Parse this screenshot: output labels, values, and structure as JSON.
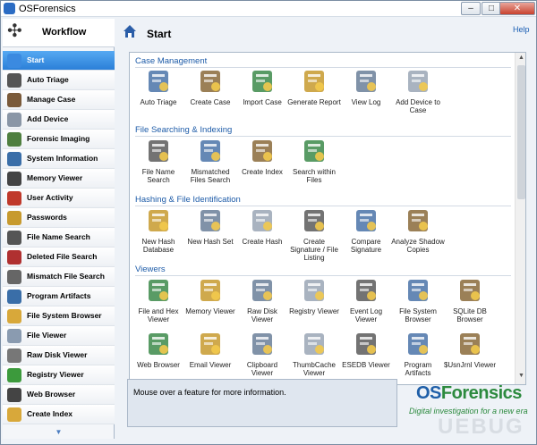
{
  "window": {
    "title": "OSForensics",
    "min": "–",
    "max": "□",
    "close": "✕"
  },
  "sidebar": {
    "header": "Workflow",
    "items": [
      {
        "label": "Start",
        "icon": "start-icon",
        "color": "#3b8ae0"
      },
      {
        "label": "Auto Triage",
        "icon": "fingerprint-icon",
        "color": "#555555"
      },
      {
        "label": "Manage Case",
        "icon": "briefcase-icon",
        "color": "#7a5a3a"
      },
      {
        "label": "Add Device",
        "icon": "disk-icon",
        "color": "#8a96a6"
      },
      {
        "label": "Forensic Imaging",
        "icon": "imaging-icon",
        "color": "#4f7f3f"
      },
      {
        "label": "System Information",
        "icon": "computer-icon",
        "color": "#3a6ea8"
      },
      {
        "label": "Memory Viewer",
        "icon": "memory-chip-icon",
        "color": "#444444"
      },
      {
        "label": "User Activity",
        "icon": "user-activity-icon",
        "color": "#c0392b"
      },
      {
        "label": "Passwords",
        "icon": "key-icon",
        "color": "#c79a2e"
      },
      {
        "label": "File Name Search",
        "icon": "binoculars-icon",
        "color": "#555555"
      },
      {
        "label": "Deleted File Search",
        "icon": "deleted-file-icon",
        "color": "#b03030"
      },
      {
        "label": "Mismatch File Search",
        "icon": "abc-icon",
        "color": "#666666"
      },
      {
        "label": "Program Artifacts",
        "icon": "program-icon",
        "color": "#3a6ea8"
      },
      {
        "label": "File System Browser",
        "icon": "folder-search-icon",
        "color": "#d8a83a"
      },
      {
        "label": "File Viewer",
        "icon": "file-viewer-icon",
        "color": "#8a9bb0"
      },
      {
        "label": "Raw Disk Viewer",
        "icon": "raw-disk-icon",
        "color": "#777777"
      },
      {
        "label": "Registry Viewer",
        "icon": "registry-icon",
        "color": "#3c9a3c"
      },
      {
        "label": "Web Browser",
        "icon": "web-icon",
        "color": "#444444"
      },
      {
        "label": "Create Index",
        "icon": "create-index-icon",
        "color": "#d8a83a"
      }
    ],
    "scroll_down": "▼"
  },
  "main": {
    "title": "Start",
    "help": "Help",
    "sections": [
      {
        "title": "Case Management"
      },
      {
        "title": "File Searching & Indexing"
      },
      {
        "title": "Hashing & File Identification"
      },
      {
        "title": "Viewers"
      }
    ],
    "tiles": [
      {
        "label": "Auto Triage",
        "icon": "fingerprint-icon"
      },
      {
        "label": "Create Case",
        "icon": "create-case-icon"
      },
      {
        "label": "Import Case",
        "icon": "import-case-icon"
      },
      {
        "label": "Generate Report",
        "icon": "report-icon"
      },
      {
        "label": "View Log",
        "icon": "log-icon"
      },
      {
        "label": "Add Device to Case",
        "icon": "add-device-icon"
      },
      {
        "label": "File Name Search",
        "icon": "binoculars-icon"
      },
      {
        "label": "Mismatched Files Search",
        "icon": "abc-icon"
      },
      {
        "label": "Create Index",
        "icon": "create-index-icon"
      },
      {
        "label": "Search within Files",
        "icon": "search-files-icon"
      },
      {
        "label": "New Hash Database",
        "icon": "hash-db-icon"
      },
      {
        "label": "New Hash Set",
        "icon": "hash-set-icon"
      },
      {
        "label": "Create Hash",
        "icon": "barcode-icon"
      },
      {
        "label": "Create Signature / File Listing",
        "icon": "signature-icon"
      },
      {
        "label": "Compare Signature",
        "icon": "compare-icon"
      },
      {
        "label": "Analyze Shadow Copies",
        "icon": "shadow-copies-icon"
      },
      {
        "label": "File and Hex Viewer",
        "icon": "hex-viewer-icon"
      },
      {
        "label": "Memory Viewer",
        "icon": "memory-chip-icon"
      },
      {
        "label": "Raw Disk Viewer",
        "icon": "raw-disk-icon"
      },
      {
        "label": "Registry Viewer",
        "icon": "registry-icon"
      },
      {
        "label": "Event Log Viewer",
        "icon": "event-log-icon"
      },
      {
        "label": "File System Browser",
        "icon": "folder-search-icon"
      },
      {
        "label": "SQLite DB Browser",
        "icon": "sqlite-icon"
      },
      {
        "label": "Web Browser",
        "icon": "web-icon"
      },
      {
        "label": "Email Viewer",
        "icon": "email-icon"
      },
      {
        "label": "Clipboard Viewer",
        "icon": "clipboard-icon"
      },
      {
        "label": "ThumbCache Viewer",
        "icon": "thumbcache-icon"
      },
      {
        "label": "ESEDB Viewer",
        "icon": "esedb-icon"
      },
      {
        "label": "Program Artifacts",
        "icon": "program-icon"
      },
      {
        "label": "$UsnJrnl Viewer",
        "icon": "usnjrnl-icon"
      }
    ],
    "info": "Mouse over a feature for more information."
  },
  "logo": {
    "brand_a": "OS",
    "brand_b": "Forensics",
    "tagline": "Digital investigation for a new era"
  },
  "watermark": "UEBUG"
}
